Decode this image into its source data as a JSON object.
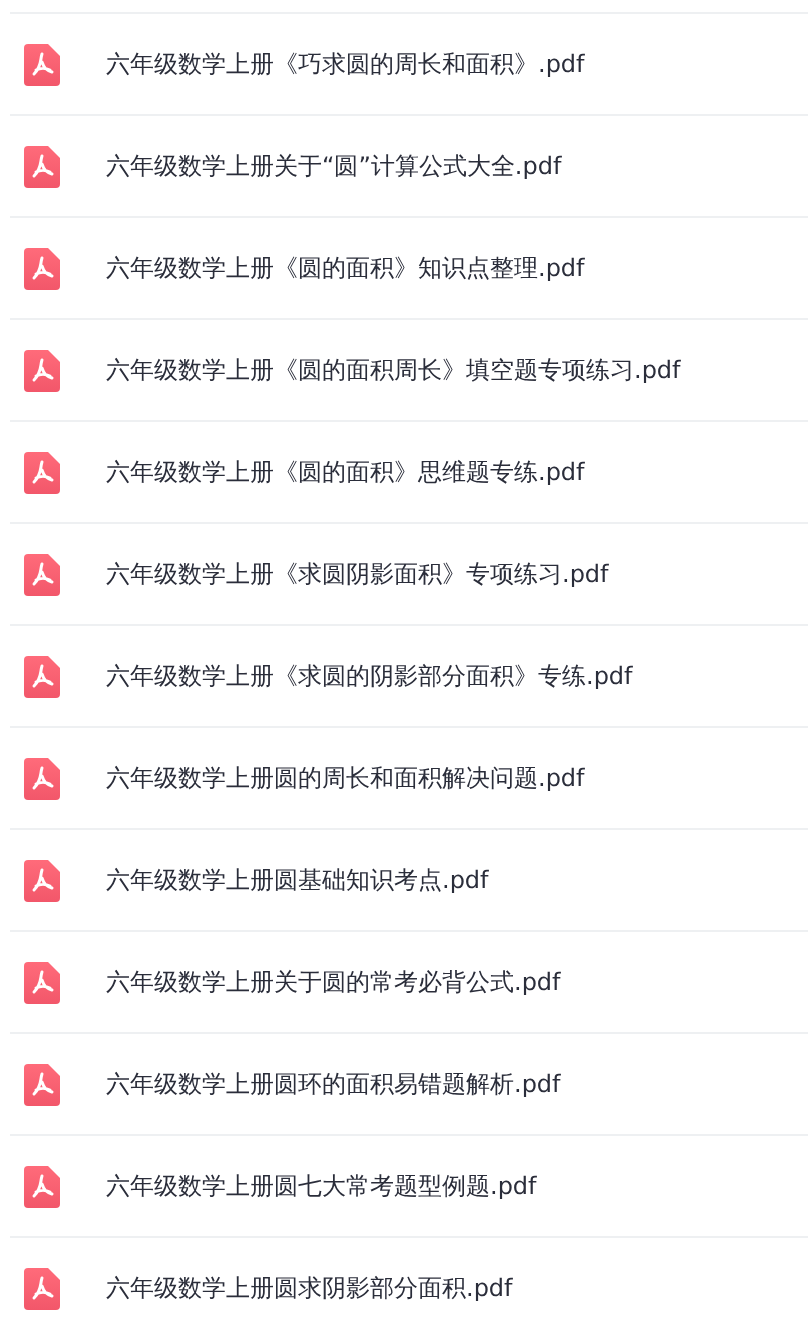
{
  "files": [
    {
      "name": "六年级数学上册《巧求圆的周长和面积》.pdf"
    },
    {
      "name": "六年级数学上册关于“圆”计算公式大全.pdf"
    },
    {
      "name": "六年级数学上册《圆的面积》知识点整理.pdf"
    },
    {
      "name": "六年级数学上册《圆的面积周长》填空题专项练习.pdf"
    },
    {
      "name": "六年级数学上册《圆的面积》思维题专练.pdf"
    },
    {
      "name": "六年级数学上册《求圆阴影面积》专项练习.pdf"
    },
    {
      "name": "六年级数学上册《求圆的阴影部分面积》专练.pdf"
    },
    {
      "name": "六年级数学上册圆的周长和面积解决问题.pdf"
    },
    {
      "name": "六年级数学上册圆基础知识考点.pdf"
    },
    {
      "name": "六年级数学上册关于圆的常考必背公式.pdf"
    },
    {
      "name": "六年级数学上册圆环的面积易错题解析.pdf"
    },
    {
      "name": "六年级数学上册圆七大常考题型例题.pdf"
    },
    {
      "name": "六年级数学上册圆求阴影部分面积.pdf"
    }
  ]
}
